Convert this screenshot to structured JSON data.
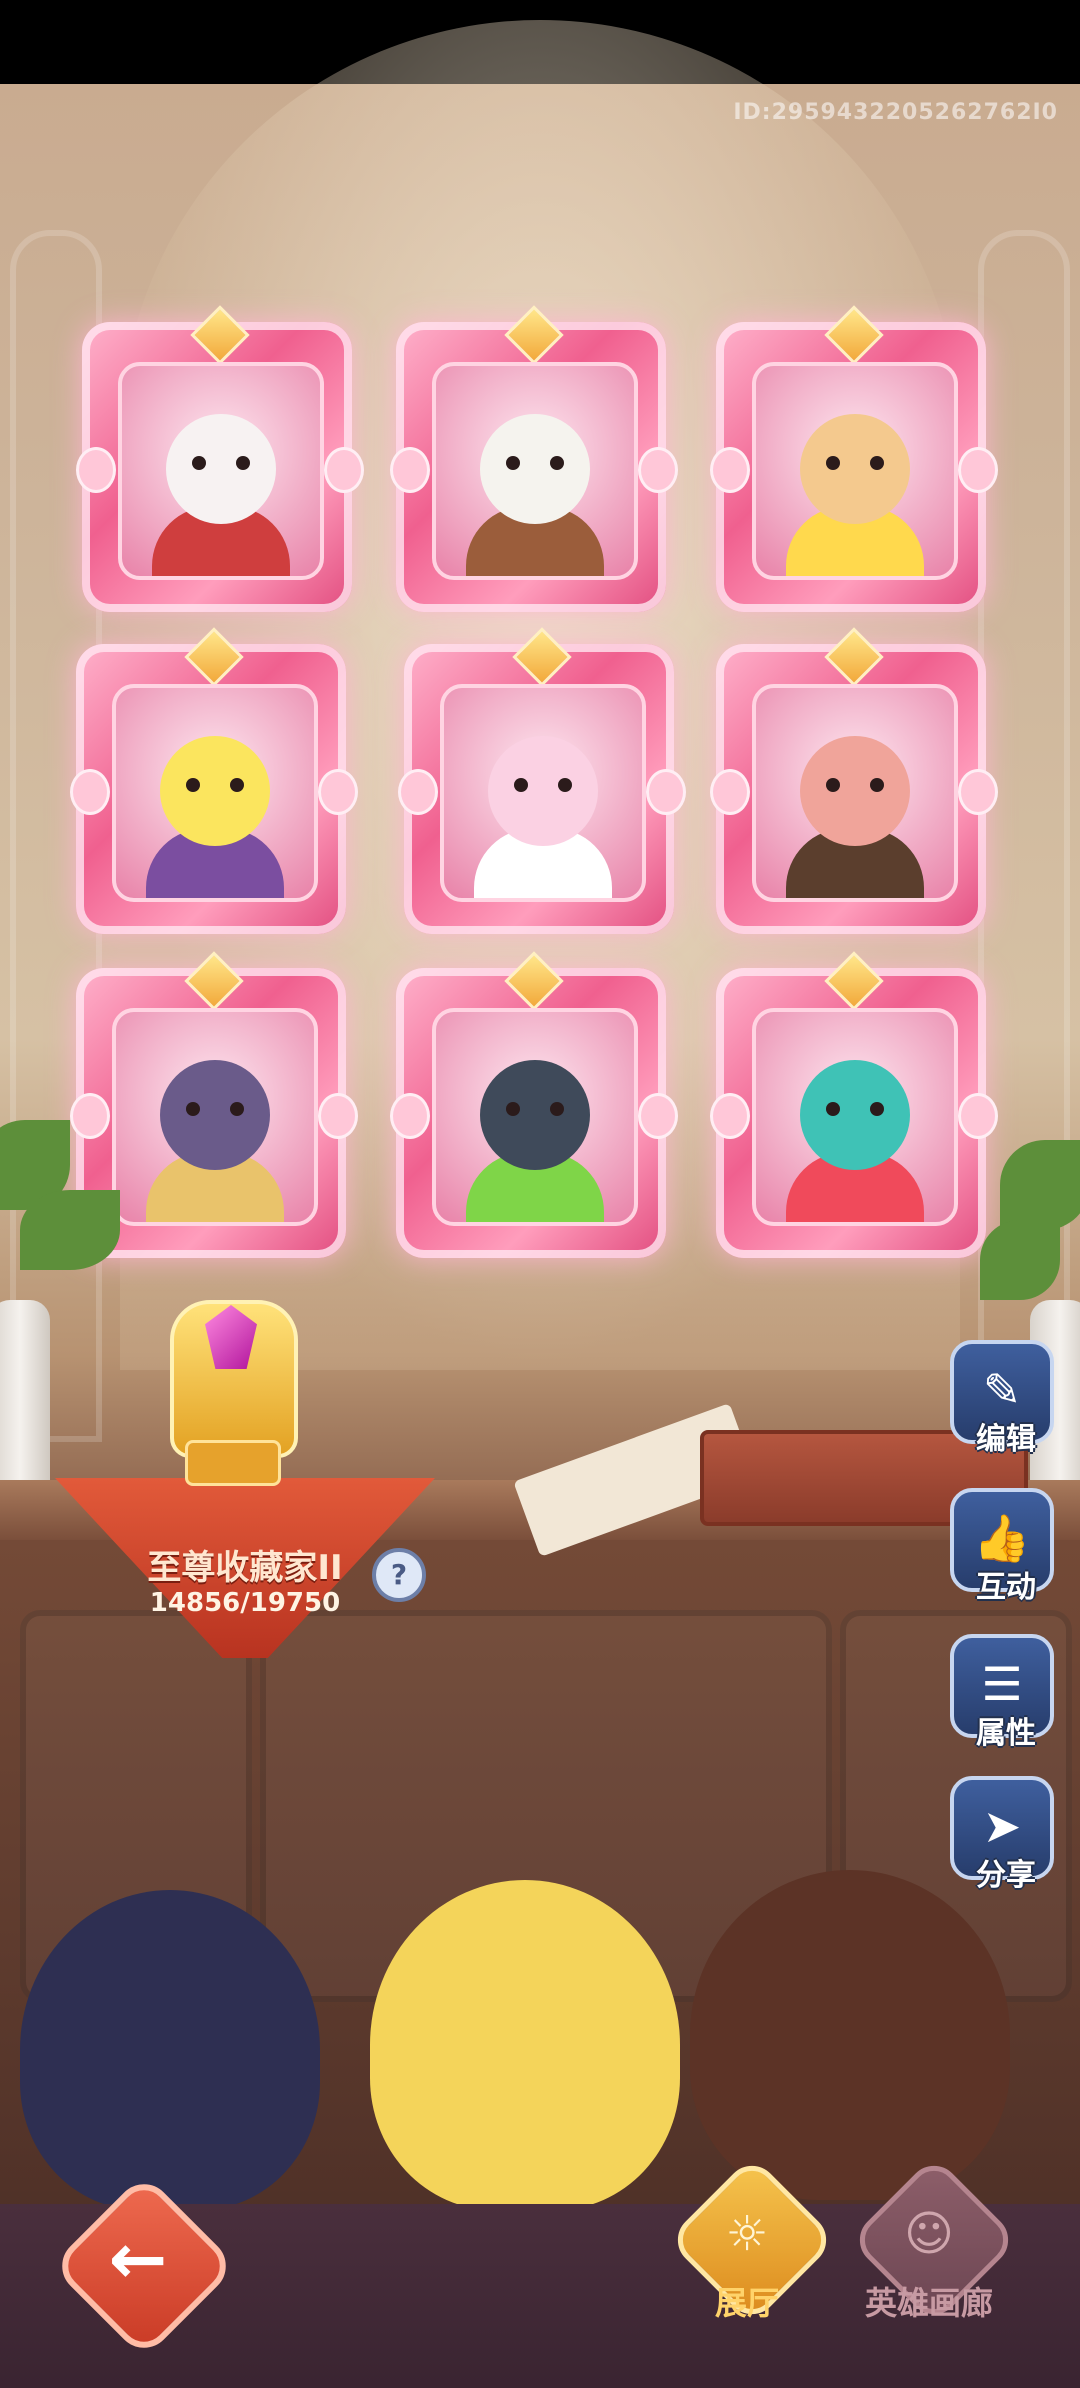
{
  "header": {
    "user_id": "ID:2959432205262762I0"
  },
  "gallery": {
    "frames": [
      {
        "hero": "white-sheep-hero",
        "color": "#f7f2f2",
        "accent": "#cf3e3e"
      },
      {
        "hero": "wizard-grandpa-hero",
        "color": "#f5f3ee",
        "accent": "#9b5d3b"
      },
      {
        "hero": "star-girl-hero",
        "color": "#f4c98e",
        "accent": "#ffd94d"
      },
      {
        "hero": "blonde-pig-hero",
        "color": "#fbe55e",
        "accent": "#7b4ea0"
      },
      {
        "hero": "pink-lamb-hero",
        "color": "#fbd1e3",
        "accent": "#ffffff"
      },
      {
        "hero": "pig-hat-hero",
        "color": "#f0a49a",
        "accent": "#5b3e2d"
      },
      {
        "hero": "dark-horn-hero",
        "color": "#6a5b8a",
        "accent": "#e9c36b"
      },
      {
        "hero": "penguin-hero",
        "color": "#3f4a5a",
        "accent": "#7fd548"
      },
      {
        "hero": "mermaid-hero",
        "color": "#3fc2b6",
        "accent": "#f04a5b"
      }
    ]
  },
  "collection": {
    "title": "至尊收藏家II",
    "progress": "14856/19750",
    "help_icon": "?"
  },
  "side_menu": {
    "edit": {
      "label": "编辑",
      "icon": "edit-icon"
    },
    "interact": {
      "label": "互动",
      "icon": "thumbs-up-icon"
    },
    "attributes": {
      "label": "属性",
      "icon": "list-icon"
    },
    "share": {
      "label": "分享",
      "icon": "send-icon"
    }
  },
  "bottom_nav": {
    "back_icon": "arrow-left-icon",
    "hall": {
      "label": "展厅",
      "icon": "hall-icon"
    },
    "gallery": {
      "label": "英雄画廊",
      "icon": "hero-gallery-icon"
    }
  },
  "colors": {
    "accent_pink": "#f0608f",
    "banner_red": "#c93a25",
    "button_blue": "#2f4a83",
    "active_gold": "#f0b33c"
  }
}
